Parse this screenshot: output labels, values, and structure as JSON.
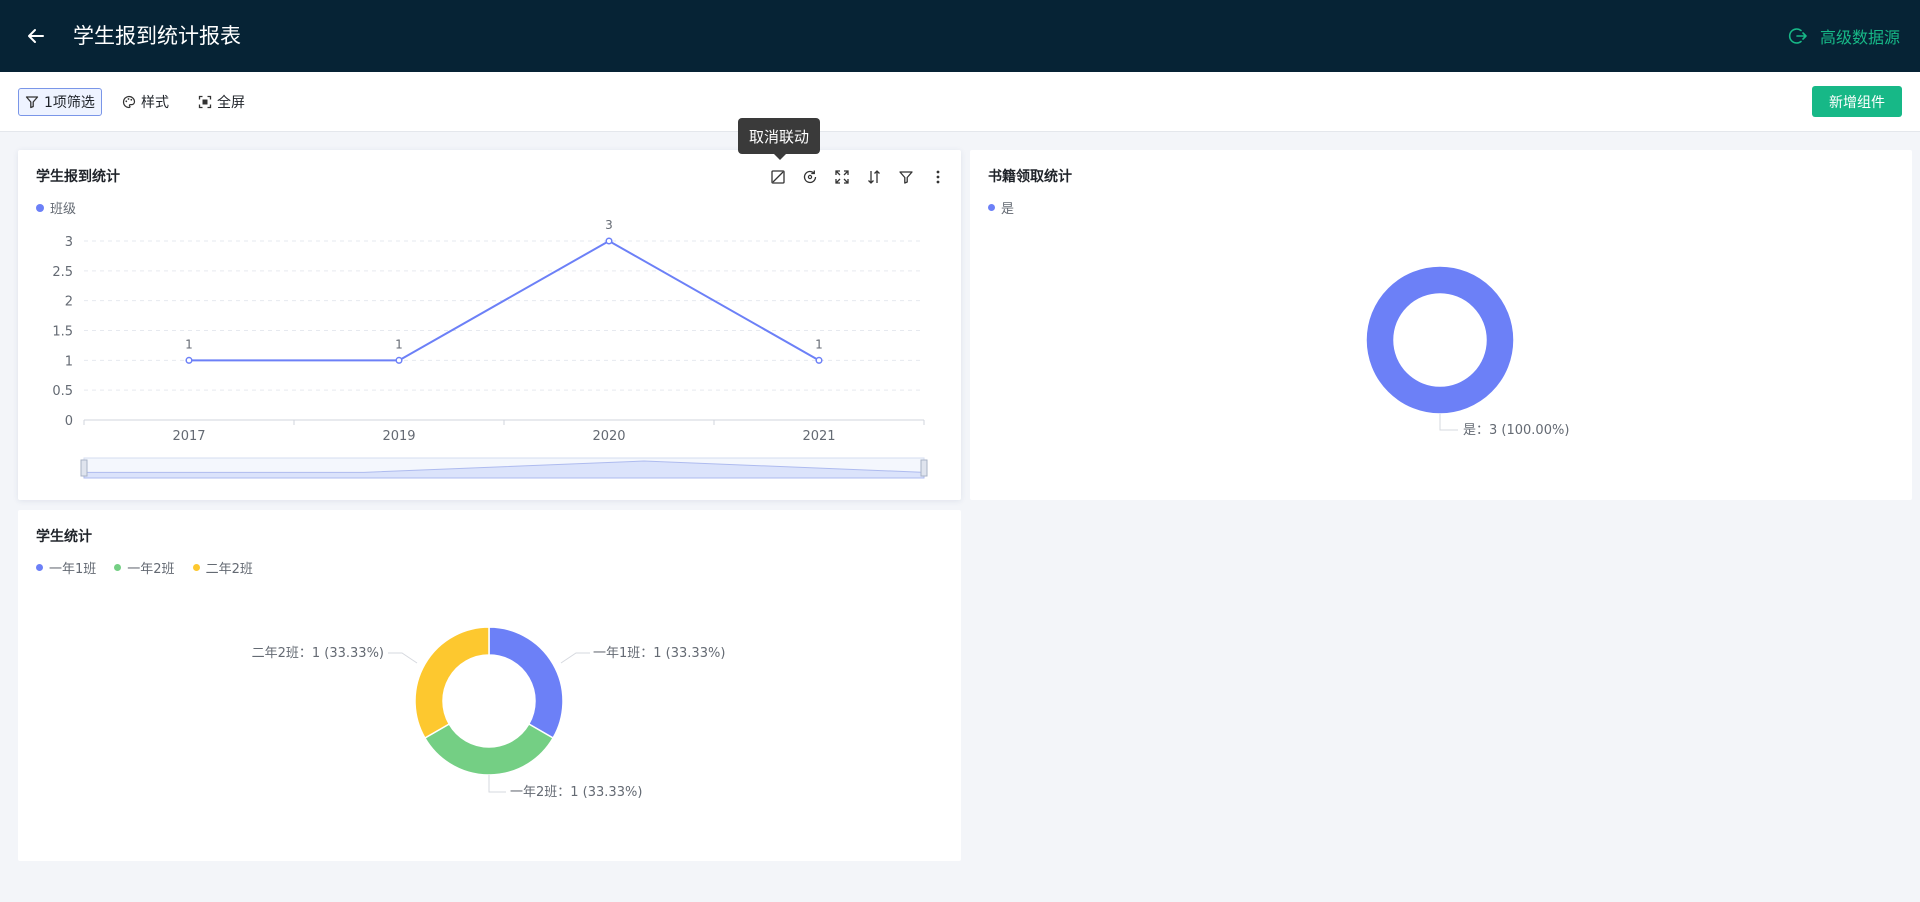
{
  "header": {
    "title": "学生报到统计报表",
    "back_icon": "arrow-left-icon",
    "advanced_source_label": "高级数据源",
    "advanced_source_icon": "logout-icon"
  },
  "toolbar": {
    "filter_label": "1项筛选",
    "style_label": "样式",
    "fullscreen_label": "全屏",
    "add_component_label": "新增组件"
  },
  "tooltip": {
    "text": "取消联动"
  },
  "colors": {
    "accent": "#17b887",
    "header_bg": "#062335",
    "blue": "#6c80f7",
    "green": "#74cf84",
    "yellow": "#fdc82f"
  },
  "cards": {
    "line": {
      "title": "学生报到统计",
      "actions": [
        "unlink-icon",
        "refresh-icon",
        "expand-icon",
        "sort-icon",
        "filter-icon",
        "more-icon"
      ]
    },
    "books": {
      "title": "书籍领取统计"
    },
    "students": {
      "title": "学生统计"
    }
  },
  "chart_data": [
    {
      "type": "line",
      "title": "学生报到统计",
      "series": [
        {
          "name": "班级",
          "values": [
            1,
            1,
            3,
            1
          ],
          "color": "#6c80f7"
        }
      ],
      "categories": [
        "2017",
        "2019",
        "2020",
        "2021"
      ],
      "y_ticks": [
        "0",
        "0.5",
        "1",
        "1.5",
        "2",
        "2.5",
        "3"
      ],
      "ylim": [
        0,
        3
      ],
      "data_labels": [
        "1",
        "1",
        "3",
        "1"
      ],
      "grid": true,
      "legend": "top-left",
      "datazoom": true
    },
    {
      "type": "pie",
      "title": "书籍领取统计",
      "donut": true,
      "legend": "top-left",
      "slices": [
        {
          "name": "是",
          "value": 3,
          "percent": "100.00%",
          "color": "#6c80f7",
          "label": "是：3 (100.00%)"
        }
      ]
    },
    {
      "type": "pie",
      "title": "学生统计",
      "donut": true,
      "legend": "top-left",
      "slices": [
        {
          "name": "一年1班",
          "value": 1,
          "percent": "33.33%",
          "color": "#6c80f7",
          "label": "一年1班：1 (33.33%)"
        },
        {
          "name": "一年2班",
          "value": 1,
          "percent": "33.33%",
          "color": "#74cf84",
          "label": "一年2班：1 (33.33%)"
        },
        {
          "name": "二年2班",
          "value": 1,
          "percent": "33.33%",
          "color": "#fdc82f",
          "label": "二年2班：1 (33.33%)"
        }
      ]
    }
  ]
}
